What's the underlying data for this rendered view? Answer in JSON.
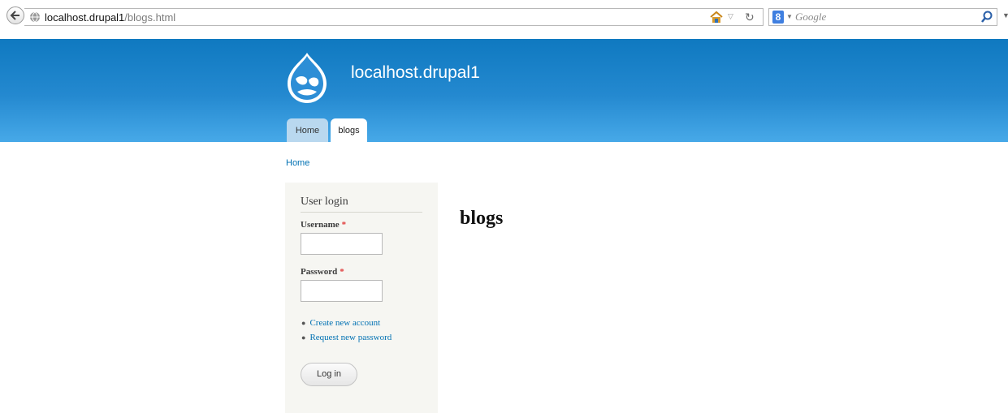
{
  "browser": {
    "url_host": "localhost.drupal1",
    "url_path": "/blogs.html",
    "search_placeholder": "Google",
    "search_engine_letter": "8"
  },
  "site": {
    "name": "localhost.drupal1",
    "tabs": [
      {
        "label": "Home",
        "active": false
      },
      {
        "label": "blogs",
        "active": true
      }
    ],
    "breadcrumb": "Home"
  },
  "sidebar": {
    "title": "User login",
    "username_label": "Username",
    "password_label": "Password",
    "required_mark": "*",
    "links": [
      {
        "label": "Create new account"
      },
      {
        "label": "Request new password"
      }
    ],
    "login_button": "Log in"
  },
  "main": {
    "title": "blogs"
  },
  "colors": {
    "header_top": "#0f79c0",
    "header_bottom": "#47a9e8",
    "link": "#0071b3",
    "sidebar_bg": "#f6f6f2"
  }
}
